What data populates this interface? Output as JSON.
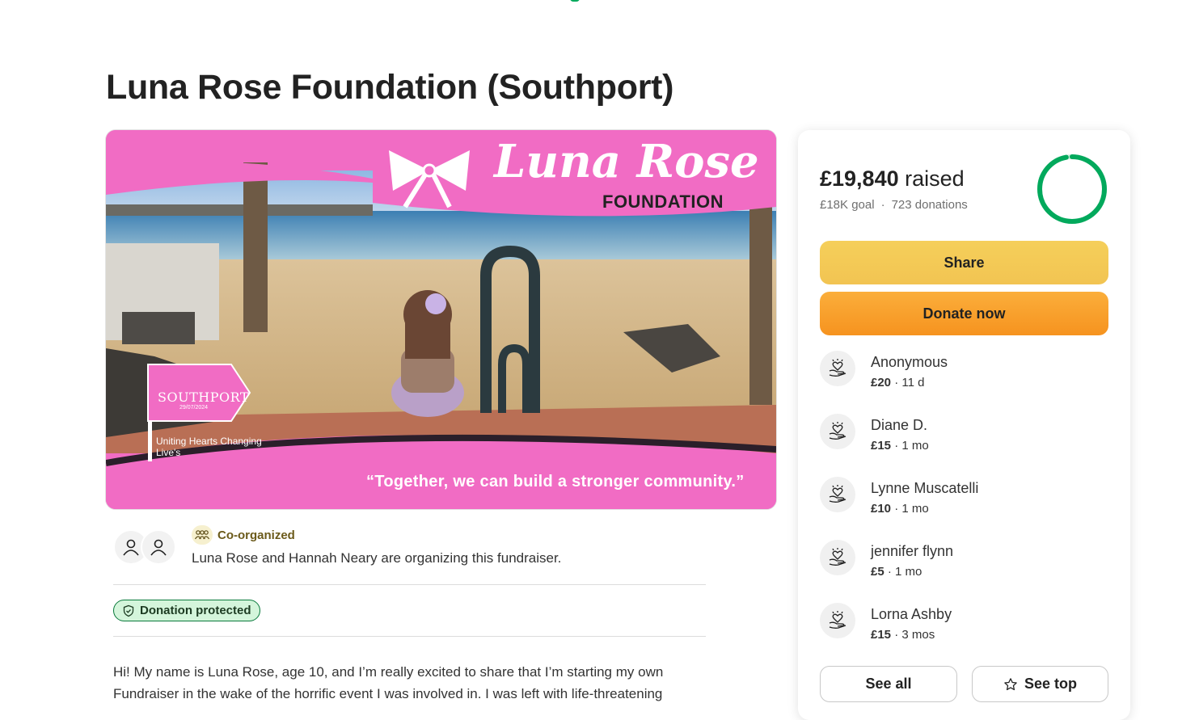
{
  "page": {
    "title": "Luna Rose Foundation (Southport)"
  },
  "hero": {
    "logo_title": "Luna Rose",
    "logo_subtitle": "FOUNDATION",
    "flag_title": "SOUTHPORT",
    "flag_date": "29/07/2024",
    "flag_caption": "Uniting Hearts Changing Live's",
    "tagline": "“Together, we can build a stronger community.”"
  },
  "organizers": {
    "badge_label": "Co-organized",
    "text": "Luna Rose and Hannah Neary are organizing this fundraiser."
  },
  "protection": {
    "label": "Donation protected"
  },
  "story": {
    "text": "Hi! My name is Luna Rose, age 10, and I’m really excited to share that I’m starting my own Fundraiser in the wake of the horrific event I was involved in. I was left with life-threatening"
  },
  "summary": {
    "raised_amount": "£19,840",
    "raised_suffix": "raised",
    "goal": "£18K goal",
    "donations": "723 donations",
    "progress_fraction": 1.0,
    "accent_color": "#02a95c"
  },
  "actions": {
    "share_label": "Share",
    "donate_label": "Donate now",
    "see_all_label": "See all",
    "see_top_label": "See top"
  },
  "donors": [
    {
      "name": "Anonymous",
      "amount": "£20",
      "time": "11 d"
    },
    {
      "name": "Diane D.",
      "amount": "£15",
      "time": "1 mo"
    },
    {
      "name": "Lynne Muscatelli",
      "amount": "£10",
      "time": "1 mo"
    },
    {
      "name": "jennifer flynn",
      "amount": "£5",
      "time": "1 mo"
    },
    {
      "name": "Lorna Ashby",
      "amount": "£15",
      "time": "3 mos"
    }
  ]
}
